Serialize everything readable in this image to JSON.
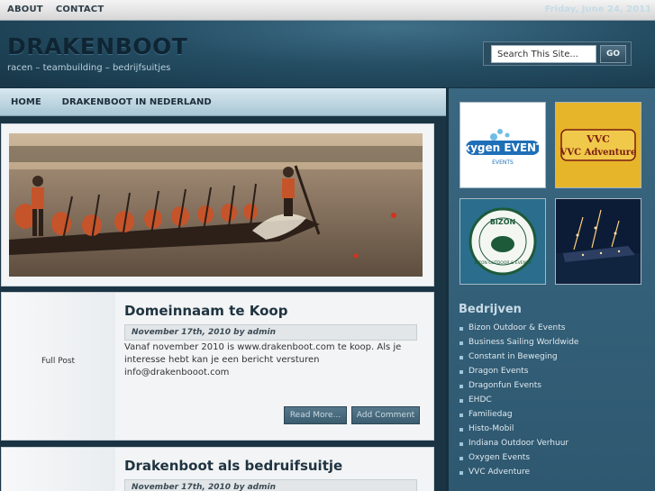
{
  "topbar": {
    "nav": [
      "ABOUT",
      "CONTACT"
    ],
    "date": "Friday, June 24, 2011"
  },
  "header": {
    "title": "DRAKENBOOT",
    "tagline": "racen – teambuilding – bedrijfsuitjes",
    "search_placeholder": "Search This Site...",
    "search_button": "GO"
  },
  "mainnav": [
    "HOME",
    "DRAKENBOOT IN NEDERLAND"
  ],
  "posts": [
    {
      "title": "Domeinnaam te Koop",
      "meta": "November 17th, 2010 by admin",
      "excerpt": "Vanaf november 2010 is www.drakenboot.com te koop. Als je interesse hebt kan je een bericht versturen info@drakenbooot.com",
      "full_post": "Full Post",
      "read_more": "Read More...",
      "add_comment": "Add Comment"
    },
    {
      "title": "Drakenboot als bedruifsuitje",
      "meta": "November 17th, 2010 by admin"
    }
  ],
  "sidebar": {
    "sponsors": [
      "Oxygen EVENTS",
      "VVC Adventure",
      "BIZON OUTDOOR & EVENTS"
    ],
    "heading": "Bedrijven",
    "links": [
      "Bizon Outdoor & Events",
      "Business Sailing Worldwide",
      "Constant in Beweging",
      "Dragon Events",
      "Dragonfun Events",
      "EHDC",
      "Familiedag",
      "Histo-Mobil",
      "Indiana Outdoor Verhuur",
      "Oxygen Events",
      "VVC Adventure"
    ]
  },
  "colors": {
    "header_bg": "#254e64",
    "sidebar_bg": "#3a6781",
    "button_bg": "#4a6b7e"
  }
}
